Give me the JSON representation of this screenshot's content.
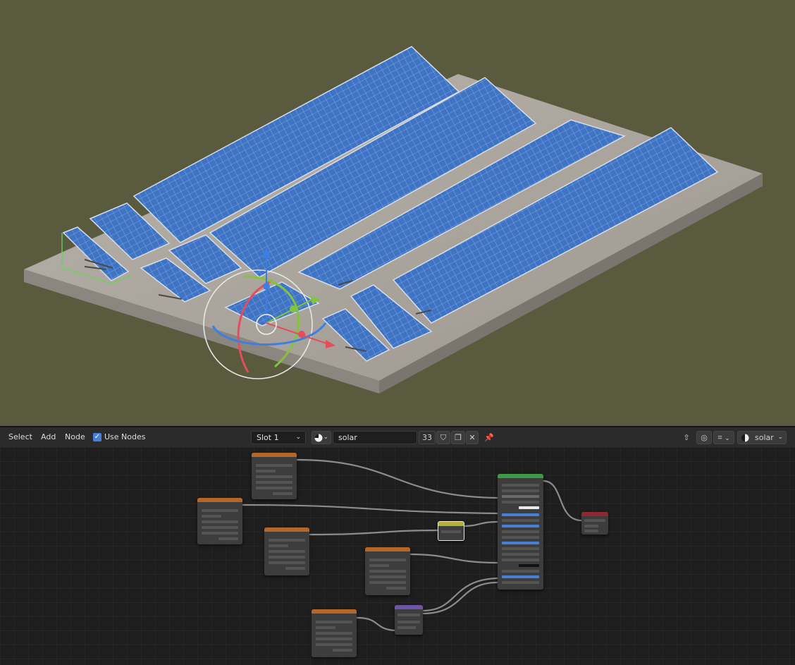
{
  "header": {
    "menus": [
      "Select",
      "Add",
      "Node"
    ],
    "use_nodes_label": "Use Nodes",
    "use_nodes_checked": true,
    "slot_value": "Slot 1",
    "material_name": "solar",
    "user_count": "33",
    "render_engine_value": "solar"
  },
  "icons": {
    "checkbox": "checkbox-checked-icon",
    "slot_dropdown": "chevron-down-icon",
    "material_browse": "material-sphere-icon",
    "fake_user": "shield-icon",
    "duplicate": "copy-icon",
    "unlink": "close-icon",
    "pin": "pin-icon",
    "parent": "arrow-up-icon",
    "overlay": "overlay-icon",
    "snap": "snap-icon",
    "world": "world-sphere-icon"
  },
  "colors": {
    "viewport_bg": "#5a5a3f",
    "editor_bg": "#1e1e1e",
    "header_bg": "#2b2b2b",
    "accent_blue": "#4a7fd8",
    "image_texture_header": "#b5672a",
    "principled_header": "#3f9a46",
    "output_header": "#8f2832",
    "converter_header": "#b6b03a",
    "vector_header": "#6f55a8",
    "gizmo_x": "#e44d5b",
    "gizmo_y": "#82c43a",
    "gizmo_z": "#3c7fe0"
  }
}
